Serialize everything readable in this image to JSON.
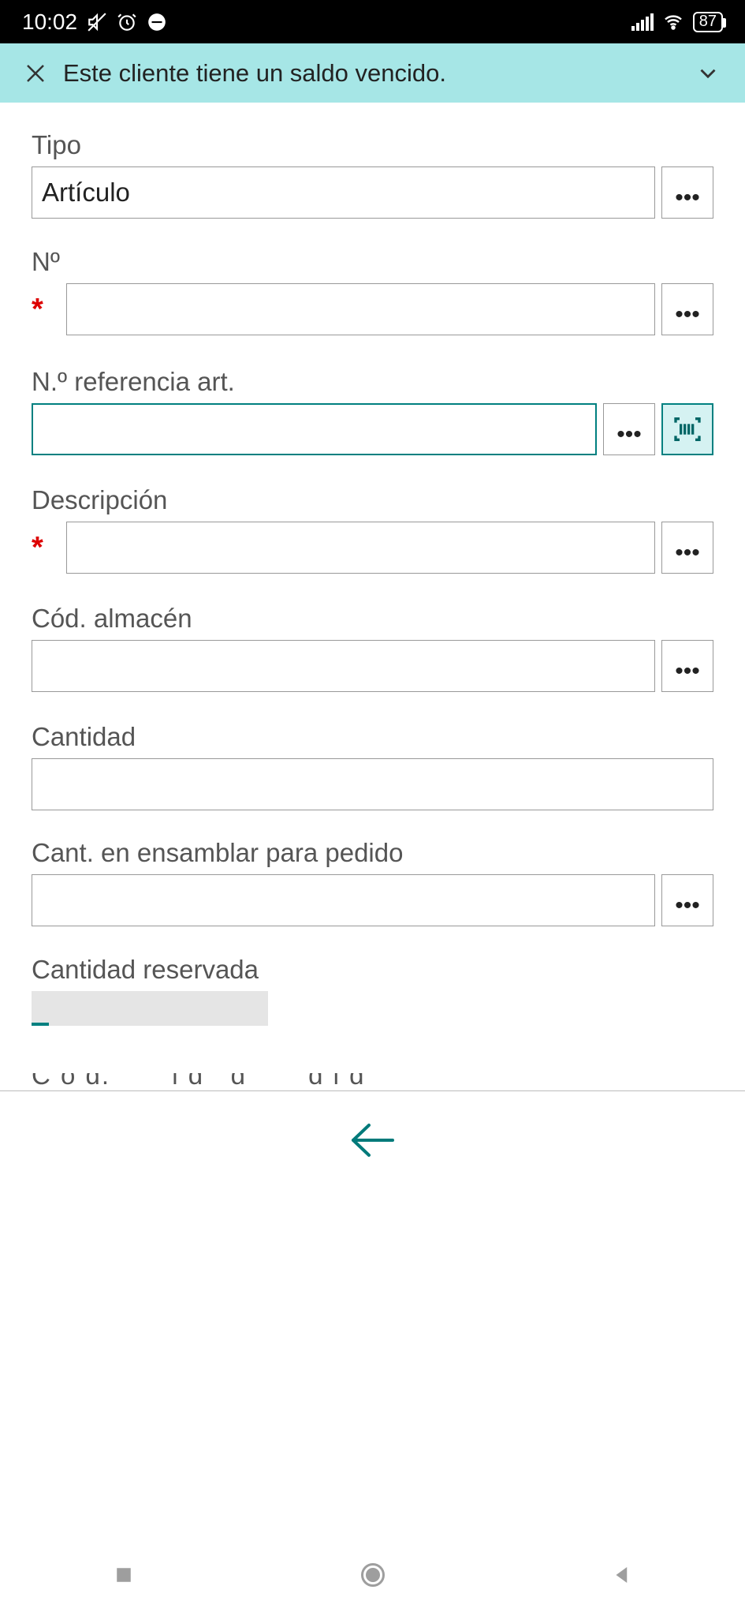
{
  "status": {
    "time": "10:02",
    "battery": "87"
  },
  "banner": {
    "message": "Este cliente tiene un saldo vencido."
  },
  "fields": {
    "tipo": {
      "label": "Tipo",
      "value": "Artículo"
    },
    "no": {
      "label": "Nº",
      "value": ""
    },
    "ref": {
      "label": "N.º referencia art.",
      "value": ""
    },
    "desc": {
      "label": "Descripción",
      "value": ""
    },
    "almacen": {
      "label": "Cód. almacén",
      "value": ""
    },
    "cantidad": {
      "label": "Cantidad",
      "value": ""
    },
    "ensamblar": {
      "label": "Cant. en ensamblar para pedido",
      "value": ""
    },
    "reservada": {
      "label": "Cantidad reservada",
      "value": ""
    },
    "partial": {
      "label": "Cód. unidad medida"
    }
  },
  "icons": {
    "ellipsis": "•••"
  }
}
